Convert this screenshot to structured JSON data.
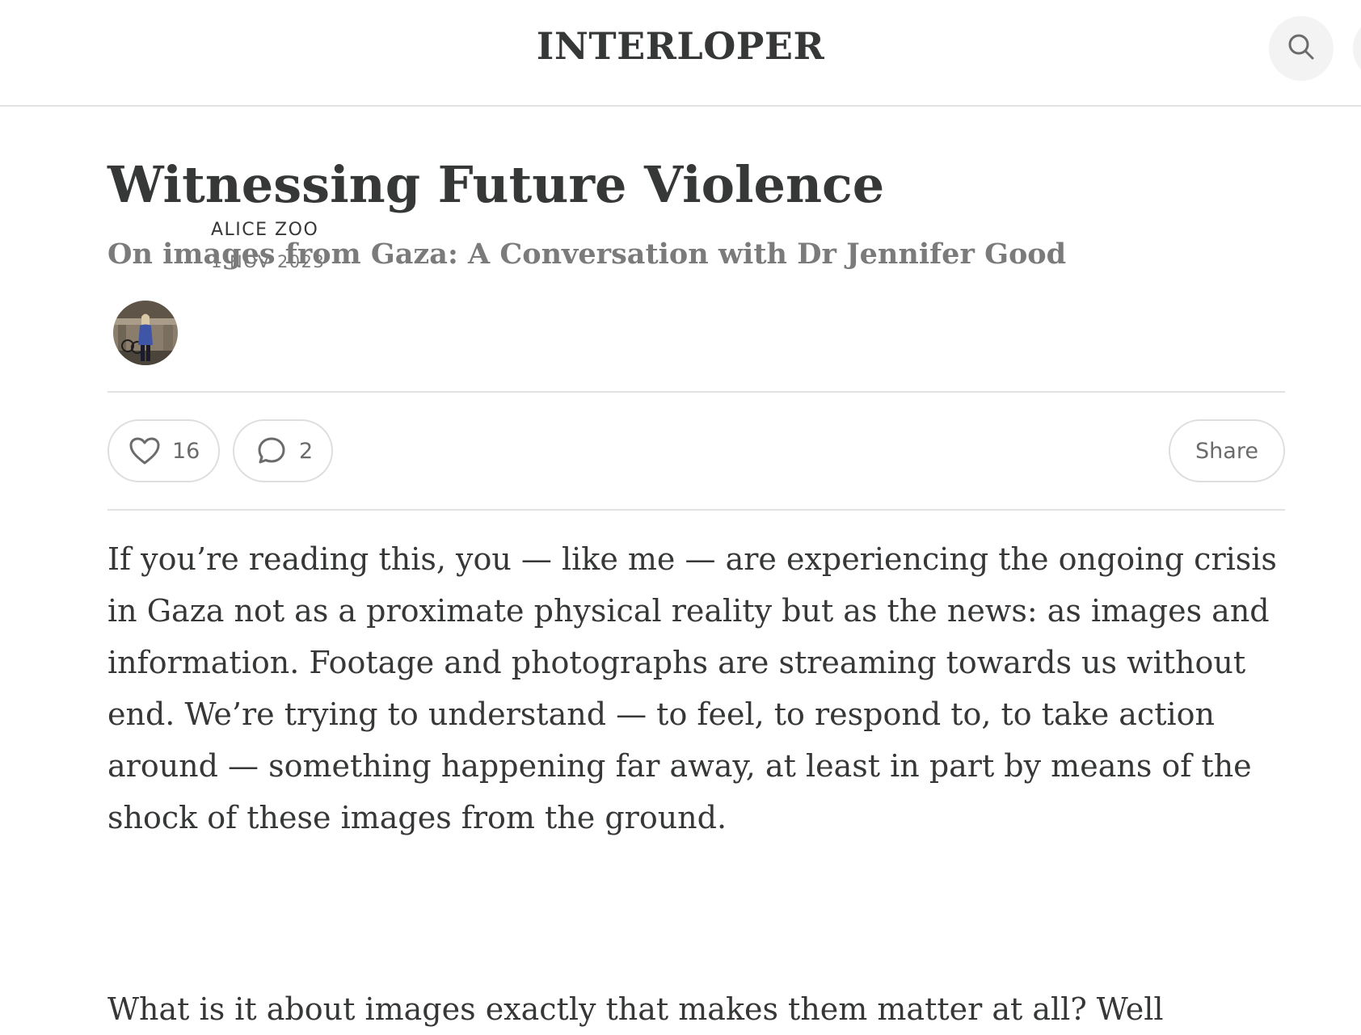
{
  "header": {
    "site_title": "INTERLOPER"
  },
  "article": {
    "title": "Witnessing Future Violence",
    "subtitle": "On images from Gaza: A Conversation with Dr Jennifer Good",
    "author": "ALICE ZOO",
    "date": "1 NOV 2023",
    "likes": "16",
    "comments": "2",
    "share_label": "Share",
    "paragraph_1": "If you’re reading this, you — like me — are experiencing the ongoing crisis in Gaza not as a proximate physical reality but as the news: as images and information. Footage and photographs are streaming towards us without end. We’re trying to understand — to feel, to respond to, to take action around — something happening far away, at least in part by means of the shock of these images from the ground.",
    "paragraph_2": "What is it about images exactly that makes them matter at all? Well"
  },
  "icons": {
    "search": "search-icon",
    "like": "heart-icon",
    "comment": "comment-icon",
    "menu": "menu-icon"
  }
}
